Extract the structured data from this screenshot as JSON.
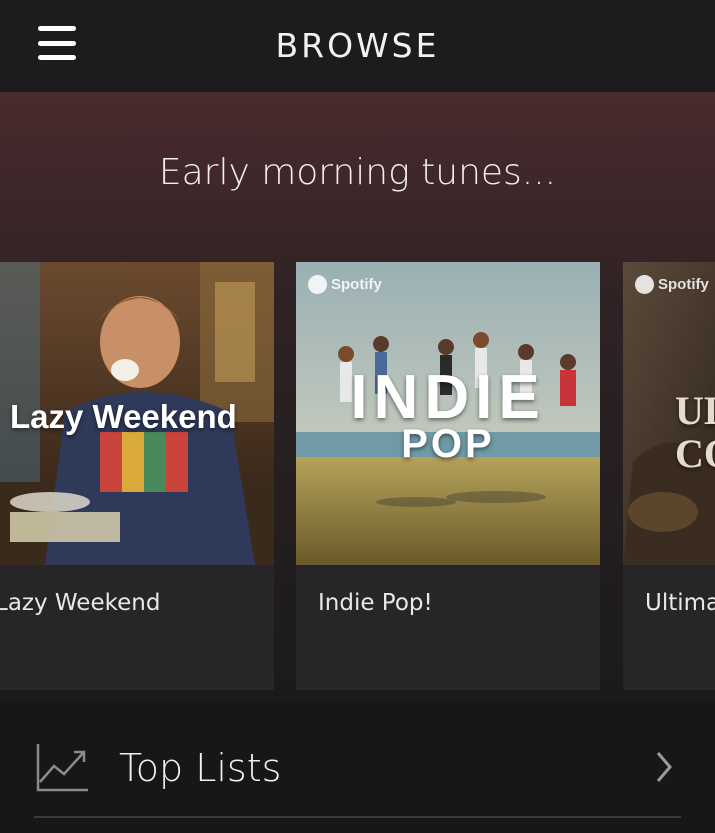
{
  "header": {
    "title": "BROWSE",
    "menu_icon": "hamburger-menu-icon"
  },
  "section": {
    "title": "Early morning tunes..."
  },
  "cards": [
    {
      "cover_title": "Lazy Weekend",
      "label": "Lazy Weekend"
    },
    {
      "brand": "Spotify",
      "cover_line1": "INDIE",
      "cover_line2": "POP",
      "label": "Indie Pop!"
    },
    {
      "brand": "Spotify",
      "cover_line1": "UL",
      "cover_line2": "CO",
      "label": "Ultima"
    }
  ],
  "top_lists": {
    "label": "Top Lists",
    "icon": "trending-chart-icon",
    "chevron": "chevron-right-icon"
  },
  "colors": {
    "background": "#161719",
    "topbar": "#1c1c1e",
    "card": "#262628",
    "hero_top": "#4a2b2e"
  }
}
